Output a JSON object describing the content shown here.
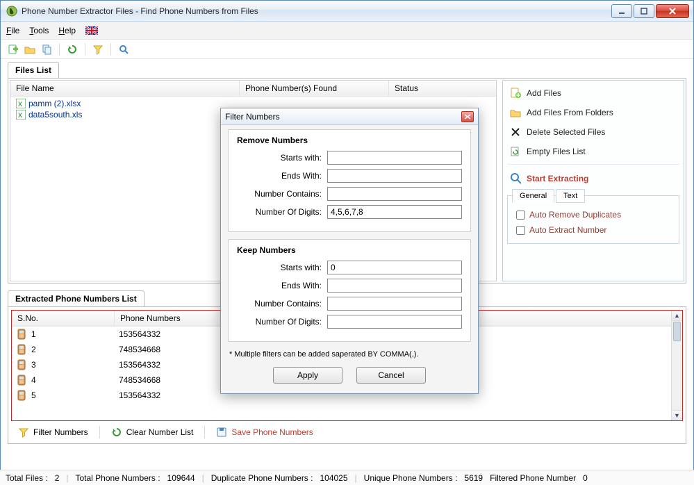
{
  "window": {
    "title": "Phone Number Extractor Files - Find Phone Numbers from Files"
  },
  "menus": {
    "file": "File",
    "tools": "Tools",
    "help": "Help"
  },
  "tabs": {
    "files_list": "Files List"
  },
  "files_table": {
    "headers": {
      "file_name": "File Name",
      "phone_found": "Phone Number(s) Found",
      "status": "Status"
    },
    "rows": [
      {
        "name": "pamm (2).xlsx",
        "found": "",
        "status": ""
      },
      {
        "name": "data5south.xls",
        "found": "",
        "status": ""
      }
    ]
  },
  "side": {
    "add_files": "Add Files",
    "add_folders": "Add Files From Folders",
    "delete_selected": "Delete Selected Files",
    "empty_list": "Empty Files List",
    "start_extracting": "Start Extracting",
    "inner_tabs": {
      "general": "General",
      "text": "Text"
    },
    "opt_auto_remove_dupes": "Auto Remove Duplicates",
    "opt_auto_extract": "Auto Extract Number"
  },
  "extracted": {
    "tab": "Extracted Phone Numbers List",
    "headers": {
      "sno": "S.No.",
      "phone": "Phone Numbers"
    },
    "rows": [
      {
        "sno": "1",
        "phone": "153564332"
      },
      {
        "sno": "2",
        "phone": "748534668"
      },
      {
        "sno": "3",
        "phone": "153564332"
      },
      {
        "sno": "4",
        "phone": "748534668"
      },
      {
        "sno": "5",
        "phone": "153564332"
      }
    ],
    "toolbar": {
      "filter": "Filter Numbers",
      "clear": "Clear Number List",
      "save": "Save Phone Numbers"
    }
  },
  "statusbar": {
    "total_files_label": "Total Files :",
    "total_files": "2",
    "total_phone_label": "Total Phone Numbers :",
    "total_phone": "109644",
    "dup_label": "Duplicate Phone Numbers :",
    "dup": "104025",
    "unique_label": "Unique Phone Numbers :",
    "unique": "5619",
    "filtered_label": "Filtered Phone Number",
    "filtered": "0"
  },
  "dialog": {
    "title": "Filter Numbers",
    "remove_title": "Remove Numbers",
    "keep_title": "Keep Numbers",
    "labels": {
      "starts": "Starts with:",
      "ends": "Ends With:",
      "contains": "Number Contains:",
      "digits": "Number Of Digits:"
    },
    "remove": {
      "starts": "",
      "ends": "",
      "contains": "",
      "digits": "4,5,6,7,8"
    },
    "keep": {
      "starts": "0",
      "ends": "",
      "contains": "",
      "digits": ""
    },
    "note": "* Multiple filters can be added saperated BY COMMA(,).",
    "apply": "Apply",
    "cancel": "Cancel"
  }
}
